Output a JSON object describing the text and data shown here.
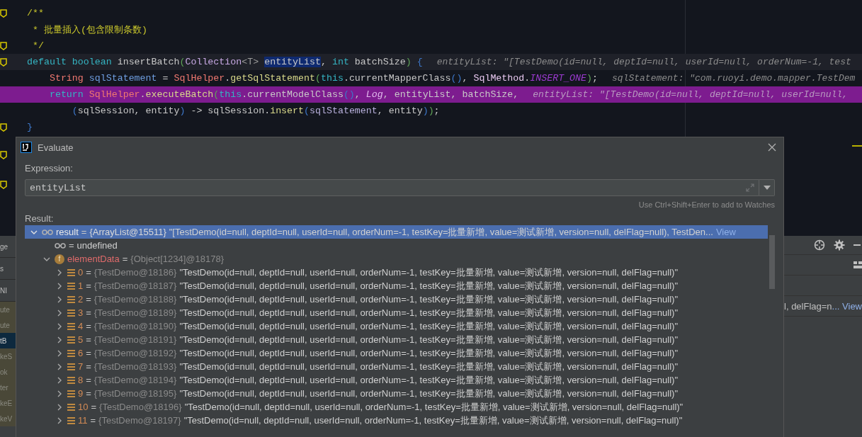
{
  "code": {
    "lines": [
      {
        "gutter_icon": true,
        "current_line": false,
        "execution_point": false,
        "tokens": [
          {
            "text": "/**",
            "kind": "comment"
          }
        ]
      },
      {
        "gutter_icon": false,
        "current_line": false,
        "execution_point": false,
        "tokens": [
          {
            "text": " * 批量插入(包含限制条数)",
            "kind": "comment"
          }
        ]
      },
      {
        "gutter_icon": true,
        "current_line": false,
        "execution_point": false,
        "tokens": [
          {
            "text": " */",
            "kind": "comment"
          }
        ]
      },
      {
        "gutter_icon": true,
        "current_line": true,
        "execution_point": false,
        "hint": "entityList: \"[TestDemo(id=null, deptId=null, userId=null, orderNum=-1, test",
        "tokens": [
          {
            "text": "default",
            "kind": "keyword"
          },
          {
            "text": " boolean",
            "kind": "keyword"
          },
          {
            "text": " insertBatch",
            "kind": "plain"
          },
          {
            "text": "(",
            "kind": "paren_green"
          },
          {
            "text": "Collection",
            "kind": "type"
          },
          {
            "text": "<T> ",
            "kind": "generic"
          },
          {
            "text": "entityList",
            "kind": "match"
          },
          {
            "text": ", ",
            "kind": "plain"
          },
          {
            "text": "int",
            "kind": "keyword"
          },
          {
            "text": " batchSize",
            "kind": "plain"
          },
          {
            "text": ")",
            "kind": "paren_green"
          },
          {
            "text": " {",
            "kind": "paren_blue"
          }
        ]
      },
      {
        "gutter_icon": false,
        "current_line": false,
        "execution_point": false,
        "hint": "sqlStatement: \"com.ruoyi.demo.mapper.TestDem",
        "tokens": [
          {
            "text": "    String",
            "kind": "class"
          },
          {
            "text": " sqlStatement",
            "kind": "field"
          },
          {
            "text": " = ",
            "kind": "plain"
          },
          {
            "text": "SqlHelper",
            "kind": "class"
          },
          {
            "text": ".",
            "kind": "plain"
          },
          {
            "text": "getSqlStatement",
            "kind": "method"
          },
          {
            "text": "(",
            "kind": "paren_green"
          },
          {
            "text": "this",
            "kind": "keyword"
          },
          {
            "text": ".currentMapperClass",
            "kind": "plain"
          },
          {
            "text": "()",
            "kind": "paren_blue"
          },
          {
            "text": ", ",
            "kind": "plain"
          },
          {
            "text": "SqlMethod",
            "kind": "enum"
          },
          {
            "text": ".",
            "kind": "plain"
          },
          {
            "text": "INSERT_ONE",
            "kind": "constant"
          },
          {
            "text": ")",
            "kind": "paren_green"
          },
          {
            "text": ";",
            "kind": "plain"
          }
        ]
      },
      {
        "gutter_icon": false,
        "current_line": false,
        "execution_point": true,
        "hint": "entityList: \"[TestDemo(id=null, deptId=null, userId=null,",
        "tokens": [
          {
            "text": "    return",
            "kind": "keyword"
          },
          {
            "text": " SqlHelper",
            "kind": "class"
          },
          {
            "text": ".",
            "kind": "plain"
          },
          {
            "text": "executeBatch",
            "kind": "method"
          },
          {
            "text": "(",
            "kind": "paren_green"
          },
          {
            "text": "this",
            "kind": "keyword"
          },
          {
            "text": ".currentModelClass",
            "kind": "plain"
          },
          {
            "text": "()",
            "kind": "paren_blue"
          },
          {
            "text": ", ",
            "kind": "plain"
          },
          {
            "text": "Log",
            "kind": "static"
          },
          {
            "text": ", entityList, batchSize,",
            "kind": "plain"
          }
        ]
      },
      {
        "gutter_icon": false,
        "current_line": false,
        "execution_point": false,
        "tokens": [
          {
            "text": "        (",
            "kind": "paren_blue"
          },
          {
            "text": "sqlSession, entity",
            "kind": "plain"
          },
          {
            "text": ")",
            "kind": "paren_blue"
          },
          {
            "text": " -> sqlSession.",
            "kind": "plain"
          },
          {
            "text": "insert",
            "kind": "method"
          },
          {
            "text": "(",
            "kind": "paren_blue"
          },
          {
            "text": "sqlStatement",
            "kind": "param"
          },
          {
            "text": ", entity",
            "kind": "plain"
          },
          {
            "text": ")",
            "kind": "paren_blue"
          },
          {
            "text": ")",
            "kind": "paren_green"
          },
          {
            "text": ";",
            "kind": "plain"
          }
        ]
      },
      {
        "gutter_icon": true,
        "current_line": false,
        "execution_point": false,
        "tokens": [
          {
            "text": "}",
            "kind": "paren_blue"
          }
        ]
      }
    ]
  },
  "left_panel": {
    "labels": [
      "ge",
      "s",
      "NI"
    ],
    "frames": [
      {
        "label": "ute",
        "selected": false
      },
      {
        "label": "ute",
        "selected": false
      },
      {
        "label": "tB",
        "selected": true
      },
      {
        "label": "keS",
        "selected": false
      },
      {
        "label": "ok",
        "selected": false
      },
      {
        "label": "ter",
        "selected": false
      },
      {
        "label": "keE",
        "selected": false
      },
      {
        "label": "keV",
        "selected": false
      }
    ]
  },
  "dialog": {
    "title": "Evaluate",
    "expression_label": "Expression:",
    "expression": {
      "value": "entityList"
    },
    "hint": "Use Ctrl+Shift+Enter to add to Watches",
    "result_label": "Result:",
    "tree": [
      {
        "kind": "watch",
        "name": "result",
        "equals": "=",
        "type": "{ArrayList@15511}",
        "value": "\"[TestDemo(id=null, deptId=null, userId=null, orderNum=-1, testKey=批量新增, value=测试新增, version=null, delFlag=null), TestDen...",
        "link": "View",
        "selected": true,
        "expanded": true,
        "children": [
          {
            "kind": "watch",
            "equals": "=",
            "value": "undefined",
            "selected": false
          },
          {
            "kind": "field",
            "icon_letter": "f",
            "name": "elementData",
            "equals": "=",
            "type": "{Object[1234]@18178}",
            "selected": false,
            "expanded": true,
            "children": [
              {
                "kind": "element",
                "name": "0",
                "equals": "=",
                "type": "{TestDemo@18186}",
                "value": "\"TestDemo(id=null, deptId=null, userId=null, orderNum=-1, testKey=批量新增, value=测试新增, version=null, delFlag=null)\"",
                "selected": false,
                "expanded": false
              },
              {
                "kind": "element",
                "name": "1",
                "equals": "=",
                "type": "{TestDemo@18187}",
                "value": "\"TestDemo(id=null, deptId=null, userId=null, orderNum=-1, testKey=批量新增, value=测试新增, version=null, delFlag=null)\"",
                "selected": false,
                "expanded": false
              },
              {
                "kind": "element",
                "name": "2",
                "equals": "=",
                "type": "{TestDemo@18188}",
                "value": "\"TestDemo(id=null, deptId=null, userId=null, orderNum=-1, testKey=批量新增, value=测试新增, version=null, delFlag=null)\"",
                "selected": false,
                "expanded": false
              },
              {
                "kind": "element",
                "name": "3",
                "equals": "=",
                "type": "{TestDemo@18189}",
                "value": "\"TestDemo(id=null, deptId=null, userId=null, orderNum=-1, testKey=批量新增, value=测试新增, version=null, delFlag=null)\"",
                "selected": false,
                "expanded": false
              },
              {
                "kind": "element",
                "name": "4",
                "equals": "=",
                "type": "{TestDemo@18190}",
                "value": "\"TestDemo(id=null, deptId=null, userId=null, orderNum=-1, testKey=批量新增, value=测试新增, version=null, delFlag=null)\"",
                "selected": false,
                "expanded": false
              },
              {
                "kind": "element",
                "name": "5",
                "equals": "=",
                "type": "{TestDemo@18191}",
                "value": "\"TestDemo(id=null, deptId=null, userId=null, orderNum=-1, testKey=批量新增, value=测试新增, version=null, delFlag=null)\"",
                "selected": false,
                "expanded": false
              },
              {
                "kind": "element",
                "name": "6",
                "equals": "=",
                "type": "{TestDemo@18192}",
                "value": "\"TestDemo(id=null, deptId=null, userId=null, orderNum=-1, testKey=批量新增, value=测试新增, version=null, delFlag=null)\"",
                "selected": false,
                "expanded": false
              },
              {
                "kind": "element",
                "name": "7",
                "equals": "=",
                "type": "{TestDemo@18193}",
                "value": "\"TestDemo(id=null, deptId=null, userId=null, orderNum=-1, testKey=批量新增, value=测试新增, version=null, delFlag=null)\"",
                "selected": false,
                "expanded": false
              },
              {
                "kind": "element",
                "name": "8",
                "equals": "=",
                "type": "{TestDemo@18194}",
                "value": "\"TestDemo(id=null, deptId=null, userId=null, orderNum=-1, testKey=批量新增, value=测试新增, version=null, delFlag=null)\"",
                "selected": false,
                "expanded": false
              },
              {
                "kind": "element",
                "name": "9",
                "equals": "=",
                "type": "{TestDemo@18195}",
                "value": "\"TestDemo(id=null, deptId=null, userId=null, orderNum=-1, testKey=批量新增, value=测试新增, version=null, delFlag=null)\"",
                "selected": false,
                "expanded": false
              },
              {
                "kind": "element",
                "name": "10",
                "equals": "=",
                "type": "{TestDemo@18196}",
                "value": "\"TestDemo(id=null, deptId=null, userId=null, orderNum=-1, testKey=批量新增, value=测试新增, version=null, delFlag=null)\"",
                "selected": false,
                "expanded": false
              },
              {
                "kind": "element",
                "name": "11",
                "equals": "=",
                "type": "{TestDemo@18197}",
                "value": "\"TestDemo(id=null, deptId=null, userId=null, orderNum=-1, testKey=批量新增, value=测试新增, version=null, delFlag=null)\"",
                "selected": false,
                "expanded": false
              }
            ]
          }
        ]
      }
    ]
  },
  "right_panel": {
    "value": "l, delFlag=n",
    "link": "... View"
  }
}
